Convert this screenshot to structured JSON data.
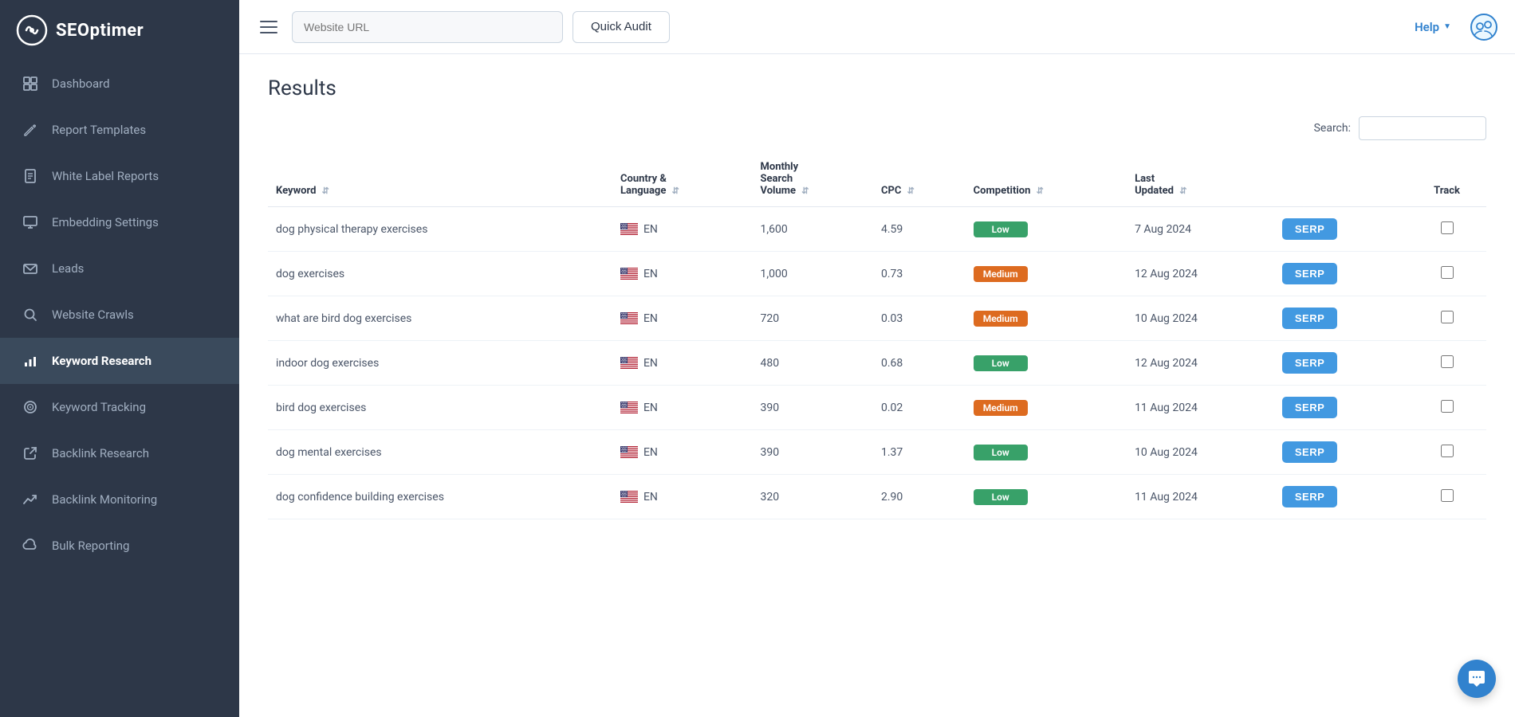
{
  "sidebar": {
    "logo_text": "SEOptimer",
    "items": [
      {
        "id": "dashboard",
        "label": "Dashboard",
        "icon": "grid-icon",
        "active": false
      },
      {
        "id": "report-templates",
        "label": "Report Templates",
        "icon": "edit-icon",
        "active": false
      },
      {
        "id": "white-label-reports",
        "label": "White Label Reports",
        "icon": "file-icon",
        "active": false
      },
      {
        "id": "embedding-settings",
        "label": "Embedding Settings",
        "icon": "monitor-icon",
        "active": false
      },
      {
        "id": "leads",
        "label": "Leads",
        "icon": "mail-icon",
        "active": false
      },
      {
        "id": "website-crawls",
        "label": "Website Crawls",
        "icon": "search-circle-icon",
        "active": false
      },
      {
        "id": "keyword-research",
        "label": "Keyword Research",
        "icon": "bar-chart-icon",
        "active": true
      },
      {
        "id": "keyword-tracking",
        "label": "Keyword Tracking",
        "icon": "target-icon",
        "active": false
      },
      {
        "id": "backlink-research",
        "label": "Backlink Research",
        "icon": "external-link-icon",
        "active": false
      },
      {
        "id": "backlink-monitoring",
        "label": "Backlink Monitoring",
        "icon": "trending-up-icon",
        "active": false
      },
      {
        "id": "bulk-reporting",
        "label": "Bulk Reporting",
        "icon": "cloud-icon",
        "active": false
      }
    ]
  },
  "header": {
    "url_placeholder": "Website URL",
    "quick_audit_label": "Quick Audit",
    "help_label": "Help",
    "hamburger_label": "Toggle menu"
  },
  "main": {
    "results_title": "Results",
    "search_label": "Search:",
    "search_placeholder": "",
    "table": {
      "columns": [
        {
          "id": "keyword",
          "label": "Keyword",
          "sortable": true
        },
        {
          "id": "country_language",
          "label": "Country & Language",
          "sortable": true
        },
        {
          "id": "monthly_search_volume",
          "label": "Monthly Search Volume",
          "sortable": true
        },
        {
          "id": "cpc",
          "label": "CPC",
          "sortable": true
        },
        {
          "id": "competition",
          "label": "Competition",
          "sortable": true
        },
        {
          "id": "last_updated",
          "label": "Last Updated",
          "sortable": true
        },
        {
          "id": "serp",
          "label": "",
          "sortable": false
        },
        {
          "id": "track",
          "label": "Track",
          "sortable": false
        }
      ],
      "rows": [
        {
          "keyword": "dog physical therapy exercises",
          "country": "EN",
          "volume": "1,600",
          "cpc": "4.59",
          "competition": "Low",
          "competition_type": "low",
          "last_updated": "7 Aug 2024"
        },
        {
          "keyword": "dog exercises",
          "country": "EN",
          "volume": "1,000",
          "cpc": "0.73",
          "competition": "Medium",
          "competition_type": "medium",
          "last_updated": "12 Aug 2024"
        },
        {
          "keyword": "what are bird dog exercises",
          "country": "EN",
          "volume": "720",
          "cpc": "0.03",
          "competition": "Medium",
          "competition_type": "medium",
          "last_updated": "10 Aug 2024"
        },
        {
          "keyword": "indoor dog exercises",
          "country": "EN",
          "volume": "480",
          "cpc": "0.68",
          "competition": "Low",
          "competition_type": "low",
          "last_updated": "12 Aug 2024"
        },
        {
          "keyword": "bird dog exercises",
          "country": "EN",
          "volume": "390",
          "cpc": "0.02",
          "competition": "Medium",
          "competition_type": "medium",
          "last_updated": "11 Aug 2024"
        },
        {
          "keyword": "dog mental exercises",
          "country": "EN",
          "volume": "390",
          "cpc": "1.37",
          "competition": "Low",
          "competition_type": "low",
          "last_updated": "10 Aug 2024"
        },
        {
          "keyword": "dog confidence building exercises",
          "country": "EN",
          "volume": "320",
          "cpc": "2.90",
          "competition": "Low",
          "competition_type": "low",
          "last_updated": "11 Aug 2024"
        }
      ],
      "serp_btn_label": "SERP"
    }
  },
  "colors": {
    "sidebar_bg": "#2d3748",
    "active_nav": "#3a4a5c",
    "accent_blue": "#4299e1",
    "badge_low": "#38a169",
    "badge_medium": "#dd6b20"
  }
}
